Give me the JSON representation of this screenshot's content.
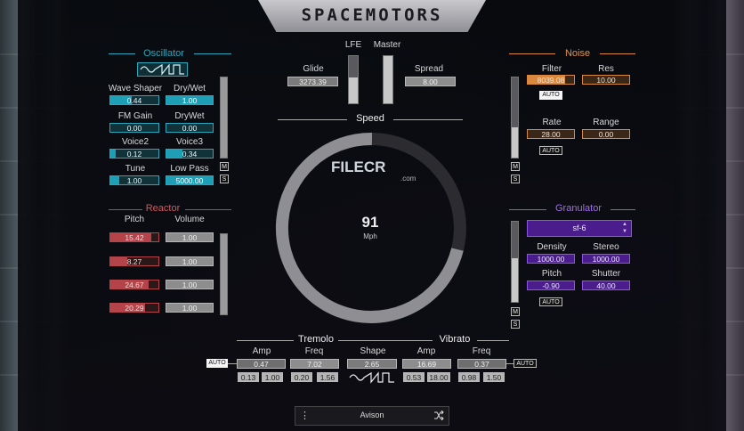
{
  "app": {
    "title": "SPACEMOTORS"
  },
  "colors": {
    "teal": "#2aa7bd",
    "red": "#b4444a",
    "orange": "#d9883e",
    "purple": "#8f52ea",
    "grey": "#8d8d8d"
  },
  "oscillator": {
    "title": "Oscillator",
    "wave_icon": "sine-saw-square-wave-icon",
    "params": [
      {
        "label": "Wave Shaper",
        "value": "0.44"
      },
      {
        "label": "Dry/Wet",
        "value": "1.00"
      },
      {
        "label": "FM Gain",
        "value": "0.00"
      },
      {
        "label": "DryWet",
        "value": "0.00"
      },
      {
        "label": "Voice2",
        "value": "0.12"
      },
      {
        "label": "Voice3",
        "value": "0.34"
      },
      {
        "label": "Tune",
        "value": "1.00"
      },
      {
        "label": "Low Pass",
        "value": "5000.00"
      }
    ],
    "level": 0.0,
    "m": "M",
    "s": "S"
  },
  "reactor": {
    "title": "Reactor",
    "pitch_label": "Pitch",
    "volume_label": "Volume",
    "rows": [
      {
        "pitch": "15.42",
        "volume": "1.00"
      },
      {
        "pitch": "8.27",
        "volume": "1.00"
      },
      {
        "pitch": "24.67",
        "volume": "1.00"
      },
      {
        "pitch": "20.29",
        "volume": "1.00"
      }
    ]
  },
  "center": {
    "lfe_label": "LFE",
    "master_label": "Master",
    "glide_label": "Glide",
    "glide_value": "3273.39",
    "spread_label": "Spread",
    "spread_value": "8.00",
    "lfe_level": 0.55,
    "master_level": 1.0,
    "speed_label": "Speed",
    "speed_value": "91",
    "speed_unit": "Mph",
    "watermark": "FILECR",
    "watermark_sub": ".com"
  },
  "noise": {
    "title": "Noise",
    "filter_label": "Filter",
    "filter_value": "8039.08",
    "res_label": "Res",
    "res_value": "10.00",
    "rate_label": "Rate",
    "rate_value": "28.00",
    "range_label": "Range",
    "range_value": "0.00",
    "auto1": "AUTO",
    "auto2": "AUTO",
    "m": "M",
    "s": "S"
  },
  "granulator": {
    "title": "Granulator",
    "preset": "sf-6",
    "density_label": "Density",
    "density_value": "1000.00",
    "stereo_label": "Stereo",
    "stereo_value": "1000.00",
    "pitch_label": "Pitch",
    "pitch_value": "-0.90",
    "shutter_label": "Shutter",
    "shutter_value": "40.00",
    "auto": "AUTO",
    "m": "M",
    "s": "S"
  },
  "tremolo": {
    "title": "Tremolo",
    "amp_label": "Amp",
    "amp_value": "0.47",
    "freq_label": "Freq",
    "freq_value": "7.02",
    "range_amp": [
      "0.13",
      "1.00"
    ],
    "range_freq": [
      "0.20",
      "1.56"
    ],
    "auto": "AUTO"
  },
  "shape": {
    "label": "Shape",
    "value": "2.65"
  },
  "vibrato": {
    "title": "Vibrato",
    "amp_label": "Amp",
    "amp_value": "16.69",
    "freq_label": "Freq",
    "freq_value": "0.37",
    "range_amp": [
      "0.53",
      "18.00"
    ],
    "range_freq": [
      "0.98",
      "1.50"
    ],
    "auto": "AUTO"
  },
  "footer": {
    "preset_name": "Avison",
    "menu_icon": "vertical-dots-icon",
    "shuffle_icon": "shuffle-icon"
  }
}
